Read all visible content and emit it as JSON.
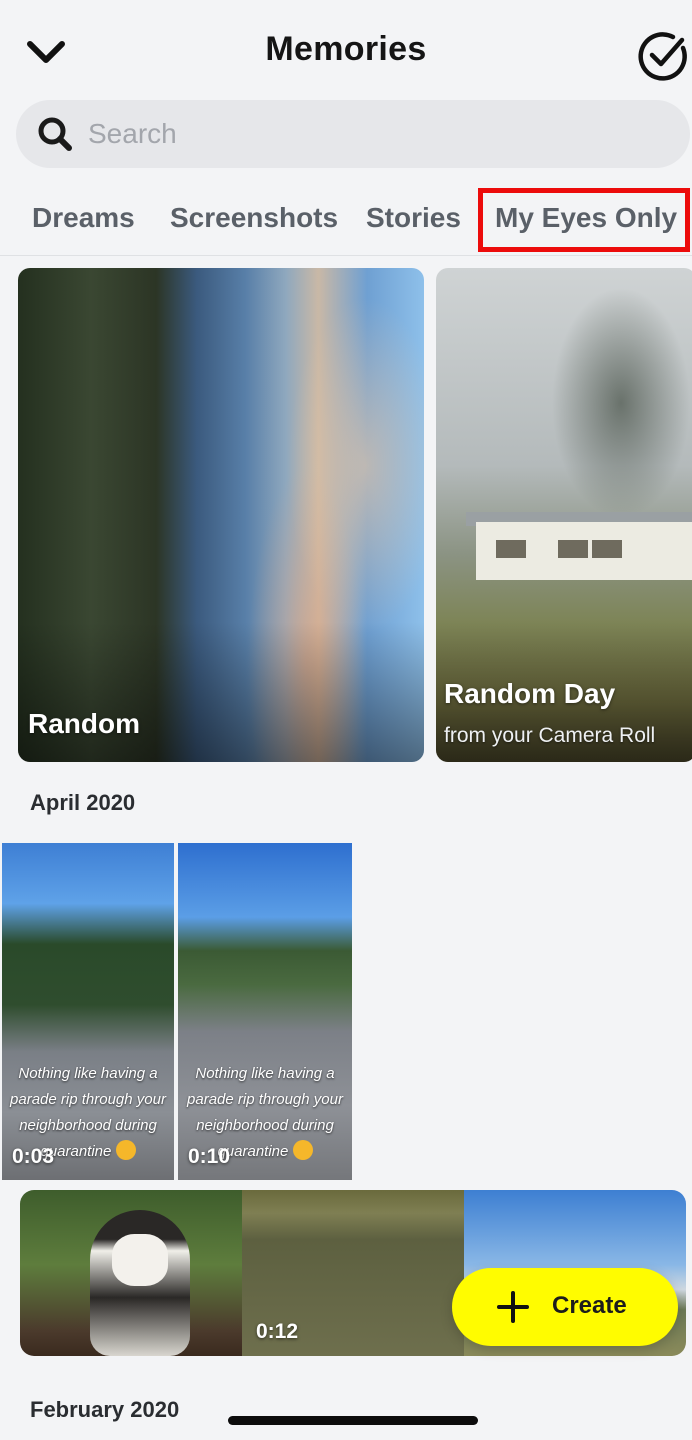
{
  "header": {
    "title": "Memories",
    "back_icon": "chevron-down-icon",
    "select_icon": "check-circle-icon"
  },
  "search": {
    "placeholder": "Search",
    "value": "",
    "icon": "search-icon"
  },
  "tabs": [
    {
      "label": "Dreams"
    },
    {
      "label": "Screenshots"
    },
    {
      "label": "Stories"
    },
    {
      "label": "My Eyes Only",
      "highlighted": true
    }
  ],
  "highlight_color": "#ec0b0b",
  "featured": [
    {
      "title": "Random",
      "subtitle": ""
    },
    {
      "title": "Random Day",
      "subtitle": "from your Camera Roll"
    }
  ],
  "sections": [
    {
      "label": "April 2020",
      "snaps": [
        {
          "caption": "Nothing like having a parade rip through your neighborhood during quarantine",
          "duration": "0:03"
        },
        {
          "caption": "Nothing like having a parade rip through your neighborhood during quarantine",
          "duration": "0:10"
        }
      ],
      "strip": [
        {
          "duration": ""
        },
        {
          "duration": "0:12"
        },
        {
          "duration": ""
        }
      ]
    },
    {
      "label": "February 2020"
    }
  ],
  "create_button": {
    "label": "Create",
    "icon": "plus-icon",
    "color": "#fffc00"
  }
}
